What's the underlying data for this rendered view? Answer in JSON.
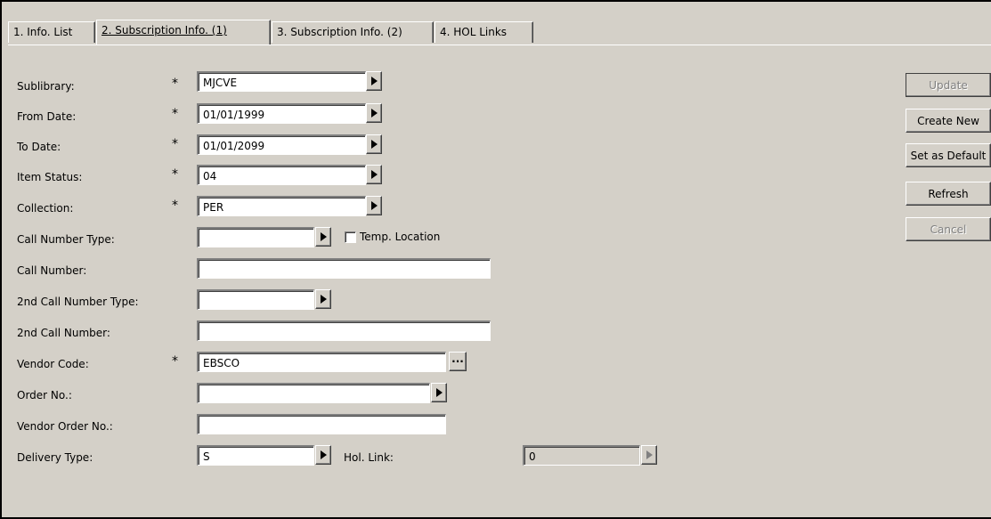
{
  "tabs": [
    {
      "label": "1. Info. List",
      "active": false
    },
    {
      "label": "2. Subscription Info. (1)",
      "active": true
    },
    {
      "label": "3. Subscription Info. (2)",
      "active": false
    },
    {
      "label": "4. HOL Links",
      "active": false
    }
  ],
  "required_marker": "*",
  "form": {
    "sublibrary": {
      "label": "Sublibrary:",
      "value": "MJCVE"
    },
    "from_date": {
      "label": "From Date:",
      "value": "01/01/1999"
    },
    "to_date": {
      "label": "To Date:",
      "value": "01/01/2099"
    },
    "item_status": {
      "label": "Item Status:",
      "value": "04"
    },
    "collection": {
      "label": "Collection:",
      "value": "PER"
    },
    "call_number_type": {
      "label": "Call Number Type:",
      "value": ""
    },
    "temp_location": {
      "label": "Temp. Location",
      "checked": false
    },
    "call_number": {
      "label": "Call Number:",
      "value": ""
    },
    "second_call_number_type": {
      "label": "2nd Call Number Type:",
      "value": ""
    },
    "second_call_number": {
      "label": "2nd Call Number:",
      "value": ""
    },
    "vendor_code": {
      "label": "Vendor Code:",
      "value": "EBSCO"
    },
    "order_no": {
      "label": "Order No.:",
      "value": ""
    },
    "vendor_order_no": {
      "label": "Vendor Order No.:",
      "value": ""
    },
    "delivery_type": {
      "label": "Delivery Type:",
      "value": "S"
    },
    "hol_link": {
      "label": "Hol. Link:",
      "value": "0"
    }
  },
  "buttons": {
    "update": {
      "label": "Update",
      "enabled": false
    },
    "create_new": {
      "label": "Create New",
      "enabled": true
    },
    "set_as_default": {
      "label": "Set as Default",
      "enabled": true
    },
    "refresh": {
      "label": "Refresh",
      "enabled": true
    },
    "cancel": {
      "label": "Cancel",
      "enabled": false
    }
  }
}
